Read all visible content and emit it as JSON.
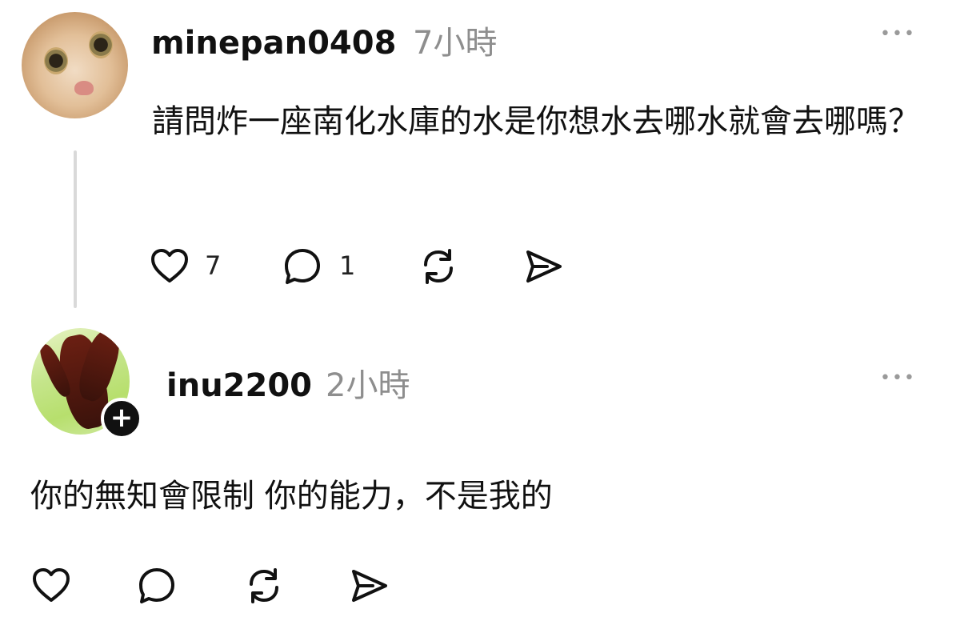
{
  "posts": [
    {
      "username": "minepan0408",
      "time": "7小時",
      "more": "•••",
      "text": "請問炸一座南化水庫的水是你想水去哪水就會去哪嗎？",
      "likes": "7",
      "replies": "1",
      "avatar": "cat-avatar"
    },
    {
      "username": "inu2200",
      "time": "2小時",
      "more": "•••",
      "text": "你的無知會限制 你的能力，不是我的",
      "avatar": "red-hair-avatar",
      "follow_badge": "+"
    }
  ],
  "icons": {
    "like": "heart-icon",
    "reply": "comment-icon",
    "repost": "repost-icon",
    "share": "send-icon"
  }
}
